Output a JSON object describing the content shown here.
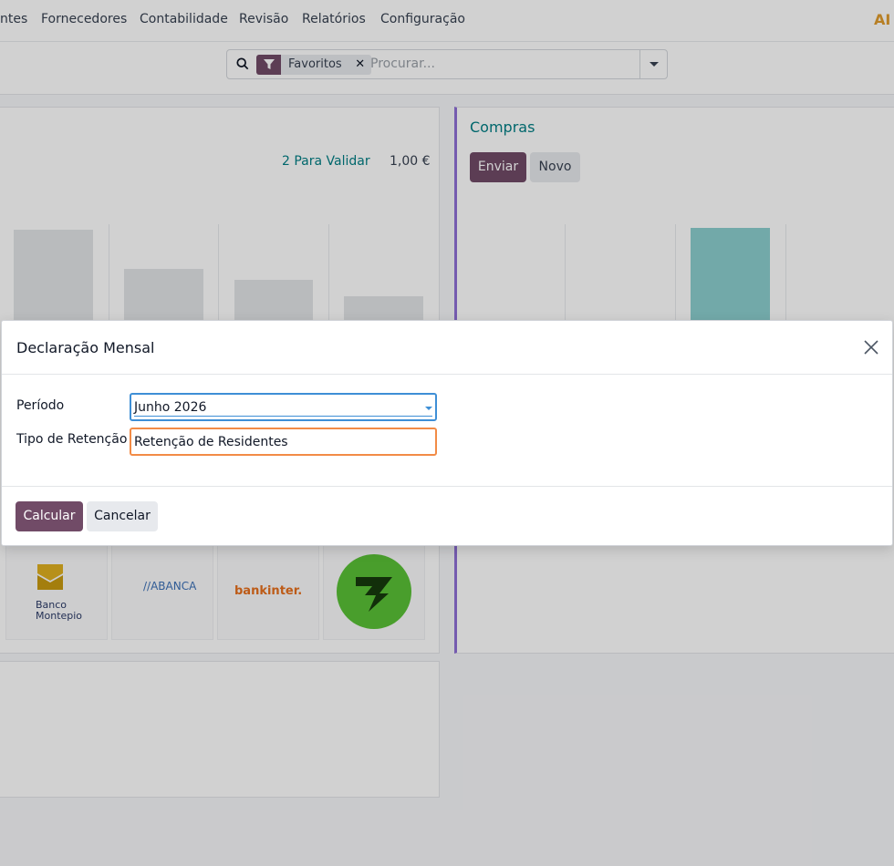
{
  "nav": {
    "items": [
      "ntes",
      "Fornecedores",
      "Contabilidade",
      "Revisão",
      "Relatórios",
      "Configuração"
    ],
    "logo_text": "AI"
  },
  "search": {
    "facet_label": "Favoritos",
    "facet_remove": "✕",
    "placeholder": "Procurar..."
  },
  "dashboard": {
    "left_card": {
      "validate_link": "2 Para Validar",
      "validate_amount": "1,00 €"
    },
    "right_card": {
      "title": "Compras",
      "send_label": "Enviar",
      "new_label": "Novo"
    },
    "banks": {
      "montepio": "Banco\nMontepio",
      "abanca": "//ABANCA",
      "bankinter": "bankinter."
    },
    "colors": {
      "accent": "#714b67",
      "teal": "#017e84",
      "purple_bar": "#8f6fd6"
    }
  },
  "modal": {
    "title": "Declaração Mensal",
    "fields": {
      "periodo_label": "Período",
      "periodo_value": "Junho 2026",
      "tipo_label": "Tipo de Retenção",
      "tipo_value": "Retenção de Residentes"
    },
    "buttons": {
      "calcular": "Calcular",
      "cancelar": "Cancelar"
    }
  }
}
